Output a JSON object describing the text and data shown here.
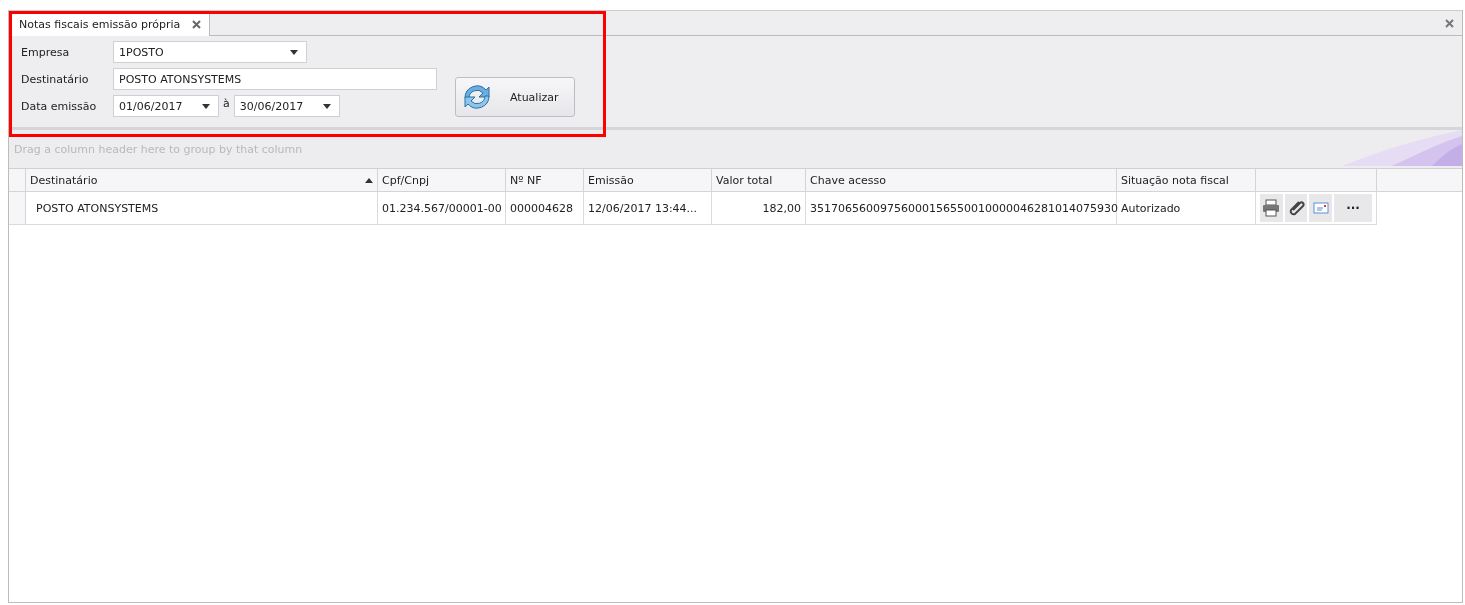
{
  "tabs": [
    {
      "label": "Notas fiscais emissão própria",
      "selected": true
    }
  ],
  "filters": {
    "empresa": {
      "label": "Empresa",
      "value": "1POSTO"
    },
    "destinatario": {
      "label": "Destinatário",
      "value": "POSTO ATONSYSTEMS"
    },
    "data_emissao": {
      "label": "Data emissão",
      "from": "01/06/2017",
      "separator": "à",
      "to": "30/06/2017"
    },
    "refresh_button": "Atualizar"
  },
  "group_panel": {
    "placeholder": "Drag a column header here to group by that column"
  },
  "table": {
    "columns": [
      {
        "label": "Destinatário",
        "sorted": true
      },
      {
        "label": "Cpf/Cnpj",
        "sorted": false
      },
      {
        "label": "Nº NF",
        "sorted": false
      },
      {
        "label": "Emissão",
        "sorted": false
      },
      {
        "label": "Valor total",
        "sorted": false
      },
      {
        "label": "Chave acesso",
        "sorted": false
      },
      {
        "label": "Situação nota fiscal",
        "sorted": false
      }
    ],
    "rows": [
      {
        "cells": [
          "POSTO ATONSYSTEMS",
          "01.234.567/00001-00",
          "000004628",
          "12/06/2017 13:44...",
          "182,00",
          "35170656009756000156550010000046281014075930",
          "Autorizado"
        ],
        "actions": [
          {
            "kind": "print"
          },
          {
            "kind": "attach"
          },
          {
            "kind": "email"
          },
          {
            "kind": "more",
            "label": "···"
          }
        ]
      }
    ]
  }
}
